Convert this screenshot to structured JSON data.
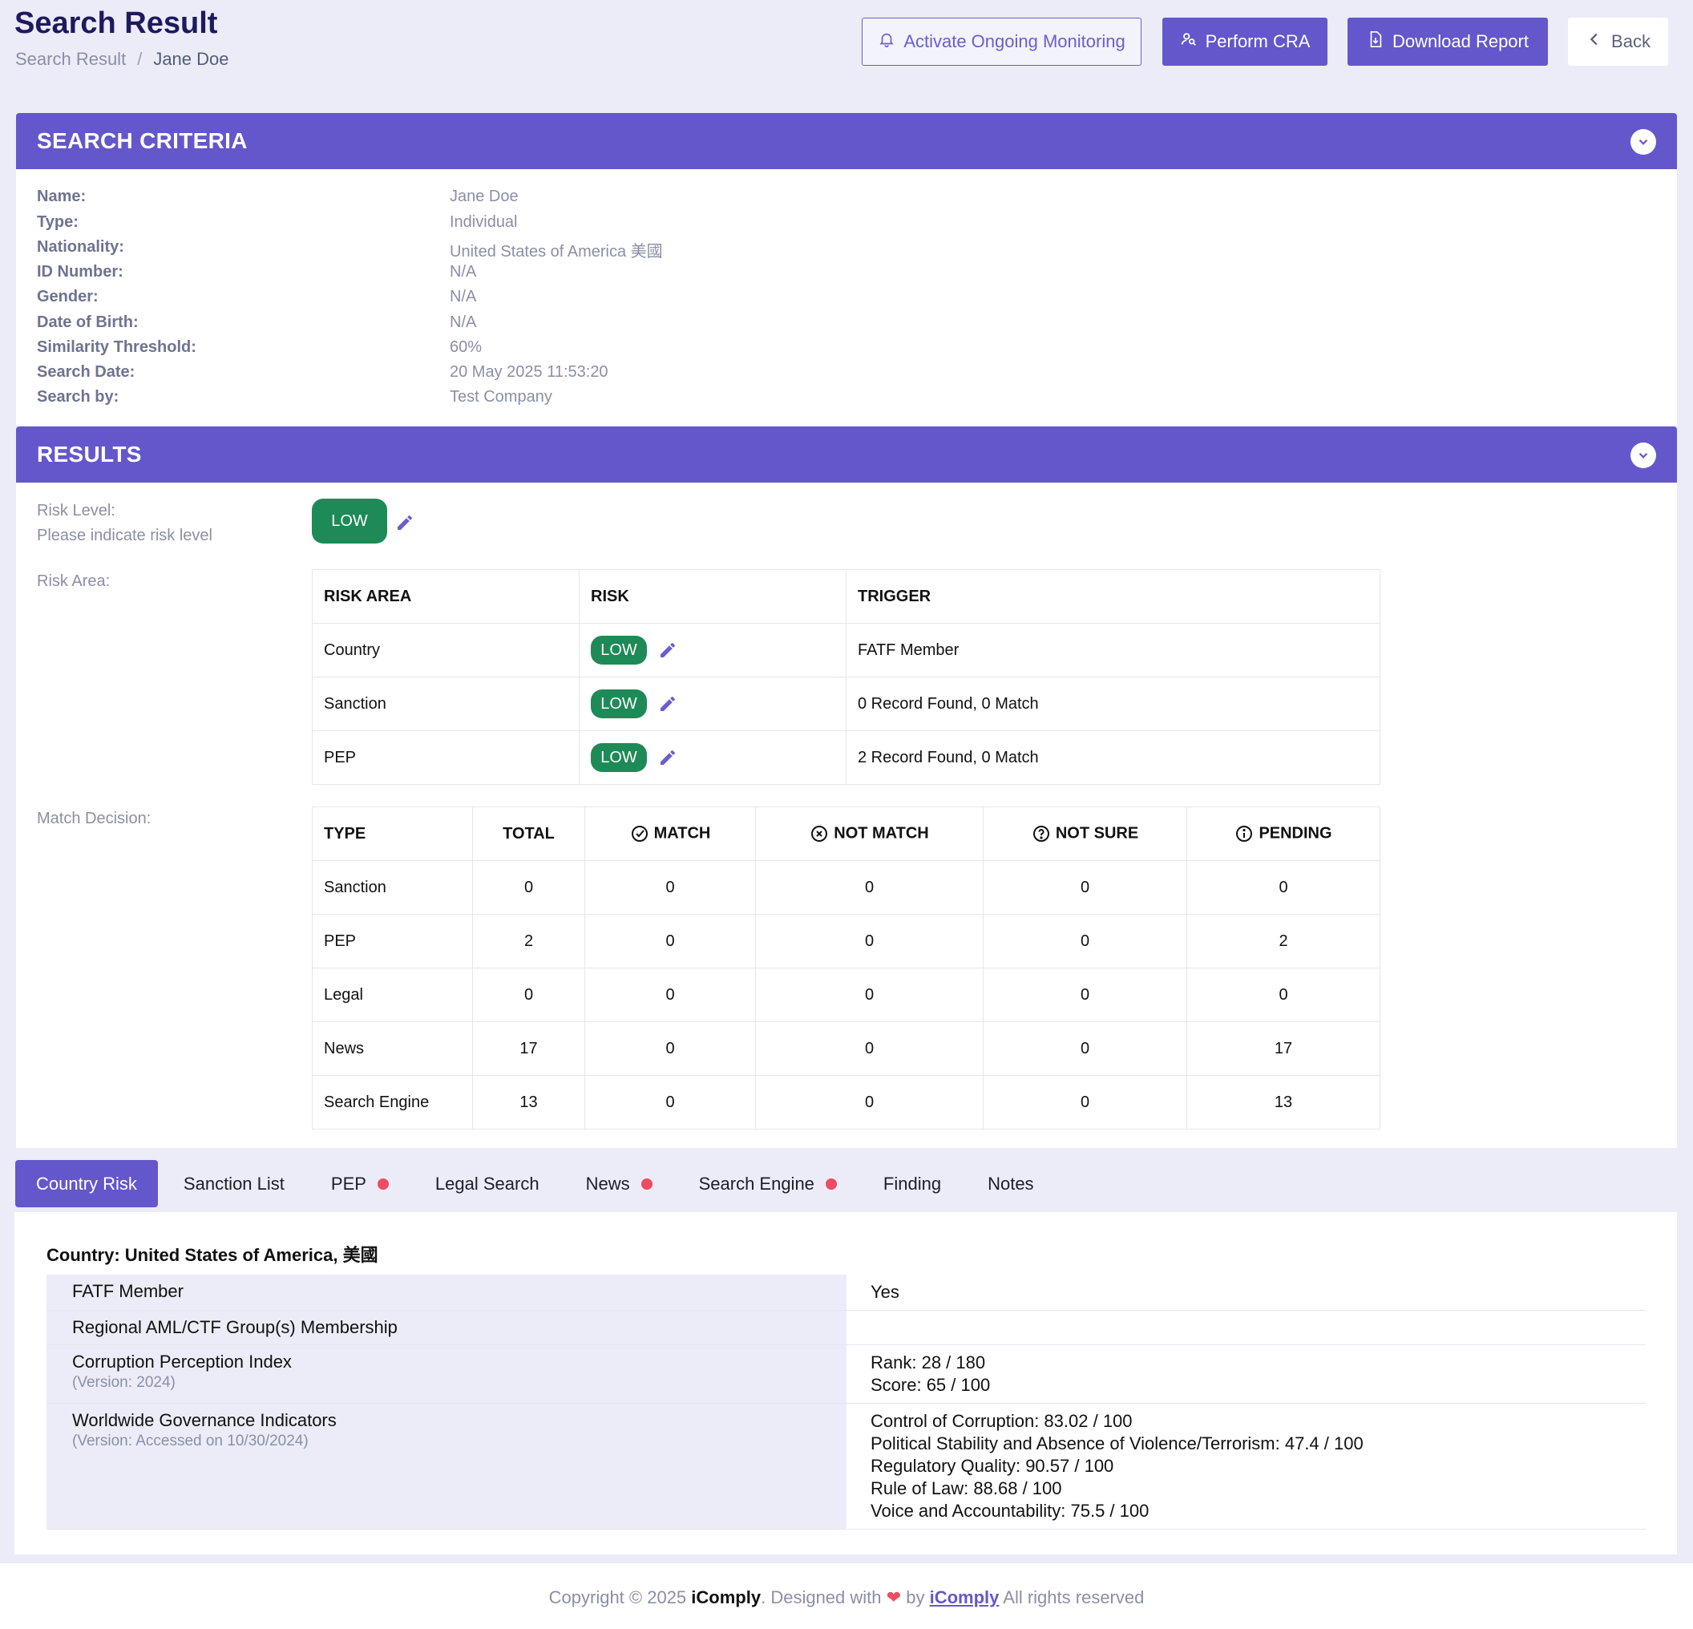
{
  "header": {
    "title": "Search Result",
    "breadcrumb_root": "Search Result",
    "breadcrumb_sep": "/",
    "breadcrumb_current": "Jane Doe",
    "buttons": {
      "monitor": "Activate Ongoing Monitoring",
      "cra": "Perform CRA",
      "download": "Download Report",
      "back": "Back"
    }
  },
  "criteria": {
    "heading": "SEARCH CRITERIA",
    "rows": [
      {
        "label": "Name:",
        "value": "Jane Doe"
      },
      {
        "label": "Type:",
        "value": "Individual"
      },
      {
        "label": "Nationality:",
        "value": "United States of America 美國"
      },
      {
        "label": "ID Number:",
        "value": "N/A"
      },
      {
        "label": "Gender:",
        "value": "N/A"
      },
      {
        "label": "Date of Birth:",
        "value": "N/A"
      },
      {
        "label": "Similarity Threshold:",
        "value": "60%"
      },
      {
        "label": "Search Date:",
        "value": "20 May 2025 11:53:20"
      },
      {
        "label": "Search by:",
        "value": "Test Company"
      }
    ]
  },
  "results": {
    "heading": "RESULTS",
    "risk_level_label": "Risk Level:",
    "risk_level_hint": "Please indicate risk level",
    "risk_level": "LOW",
    "risk_area_label": "Risk Area:",
    "risk_area_headers": [
      "RISK AREA",
      "RISK",
      "TRIGGER"
    ],
    "risk_area_rows": [
      {
        "area": "Country",
        "risk": "LOW",
        "trigger": "FATF Member"
      },
      {
        "area": "Sanction",
        "risk": "LOW",
        "trigger": "0 Record Found, 0 Match"
      },
      {
        "area": "PEP",
        "risk": "LOW",
        "trigger": "2 Record Found, 0 Match"
      }
    ],
    "match_label": "Match Decision:",
    "match_headers": [
      "TYPE",
      "TOTAL",
      "MATCH",
      "NOT MATCH",
      "NOT SURE",
      "PENDING"
    ],
    "match_rows": [
      {
        "type": "Sanction",
        "total": "0",
        "match": "0",
        "not_match": "0",
        "not_sure": "0",
        "pending": "0"
      },
      {
        "type": "PEP",
        "total": "2",
        "match": "0",
        "not_match": "0",
        "not_sure": "0",
        "pending": "2"
      },
      {
        "type": "Legal",
        "total": "0",
        "match": "0",
        "not_match": "0",
        "not_sure": "0",
        "pending": "0"
      },
      {
        "type": "News",
        "total": "17",
        "match": "0",
        "not_match": "0",
        "not_sure": "0",
        "pending": "17"
      },
      {
        "type": "Search Engine",
        "total": "13",
        "match": "0",
        "not_match": "0",
        "not_sure": "0",
        "pending": "13"
      }
    ]
  },
  "tabs": [
    {
      "label": "Country Risk",
      "active": true,
      "alert": false
    },
    {
      "label": "Sanction List",
      "active": false,
      "alert": false
    },
    {
      "label": "PEP",
      "active": false,
      "alert": true
    },
    {
      "label": "Legal Search",
      "active": false,
      "alert": false
    },
    {
      "label": "News",
      "active": false,
      "alert": true
    },
    {
      "label": "Search Engine",
      "active": false,
      "alert": true
    },
    {
      "label": "Finding",
      "active": false,
      "alert": false
    },
    {
      "label": "Notes",
      "active": false,
      "alert": false
    }
  ],
  "country": {
    "title": "Country: United States of America, 美國",
    "rows": [
      {
        "key": "FATF Member",
        "version": "",
        "values": [
          "Yes"
        ]
      },
      {
        "key": "Regional AML/CTF Group(s) Membership",
        "version": "",
        "values": [
          ""
        ]
      },
      {
        "key": "Corruption Perception Index",
        "version": "(Version: 2024)",
        "values": [
          "Rank: 28 / 180",
          "Score: 65 / 100"
        ]
      },
      {
        "key": "Worldwide Governance Indicators",
        "version": "(Version: Accessed on 10/30/2024)",
        "values": [
          "Control of Corruption: 83.02 / 100",
          "Political Stability and Absence of Violence/Terrorism: 47.4 / 100",
          "Regulatory Quality: 90.57 / 100",
          "Rule of Law: 88.68 / 100",
          "Voice and Accountability: 75.5 / 100"
        ]
      }
    ]
  },
  "footer": {
    "copyright": "Copyright © 2025",
    "brand": "iComply",
    "designed": ". Designed with",
    "by": "by",
    "link": "iComply",
    "rights": "All rights reserved"
  },
  "colors": {
    "accent": "#6457cb",
    "low_risk": "#1e8a57",
    "alert_dot": "#ee4c62",
    "page_bg": "#ebecf7"
  },
  "icons": {
    "monitor": "bell-icon",
    "cra": "user-search-icon",
    "download": "file-download-icon",
    "back": "chevron-left-icon",
    "collapse": "chevron-down-icon",
    "edit": "pencil-icon",
    "match": "check-circle-icon",
    "not_match": "x-circle-icon",
    "not_sure": "question-circle-icon",
    "pending": "info-circle-icon"
  }
}
